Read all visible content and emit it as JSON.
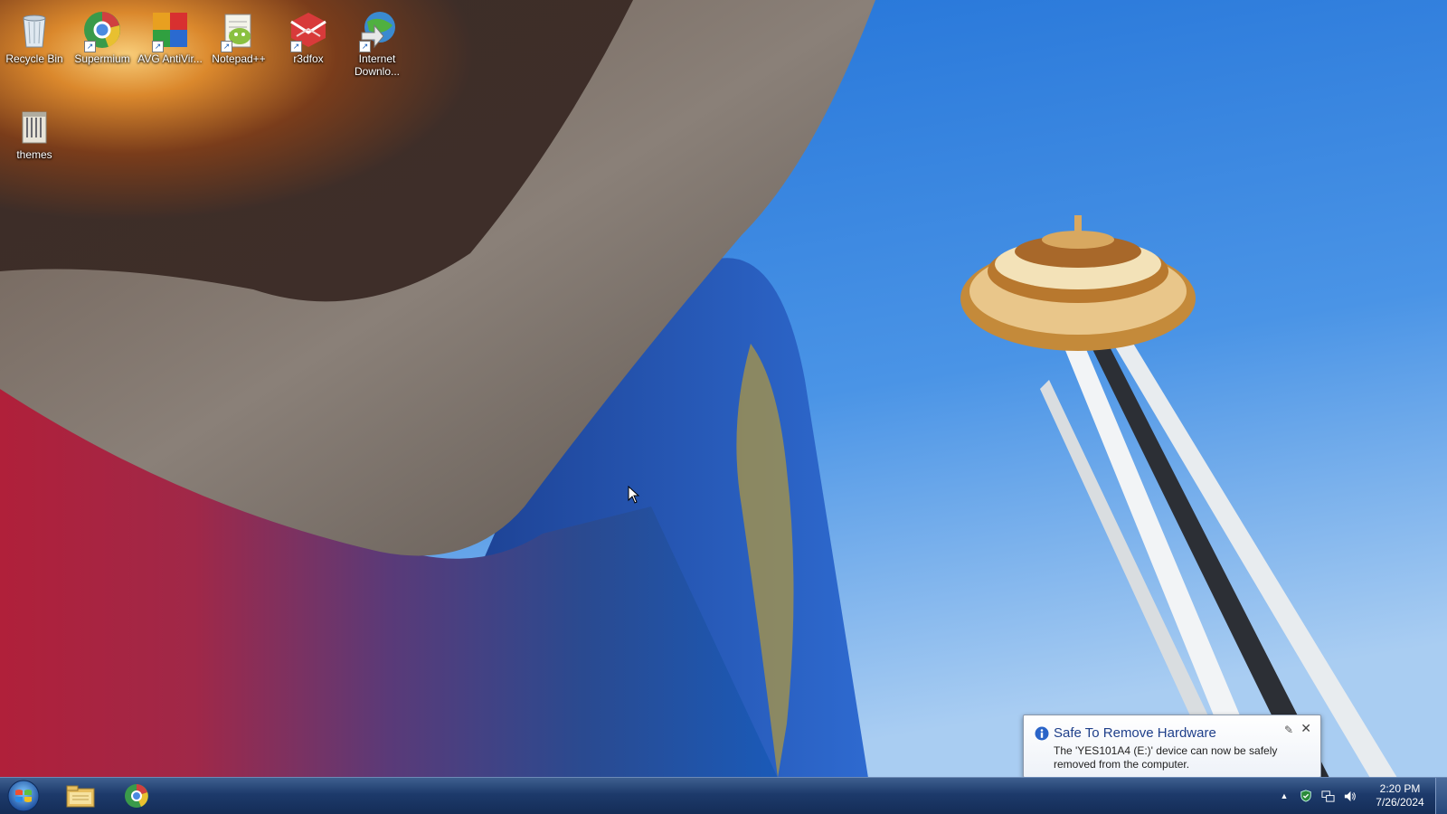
{
  "desktop": {
    "icons": [
      {
        "label": "Recycle Bin",
        "icon": "recycle-bin-icon"
      },
      {
        "label": "Supermium",
        "icon": "supermium-icon"
      },
      {
        "label": "AVG AntiVir...",
        "icon": "avg-antivirus-icon"
      },
      {
        "label": "Notepad++",
        "icon": "notepad-plus-plus-icon"
      },
      {
        "label": "r3dfox",
        "icon": "r3dfox-icon"
      },
      {
        "label": "Internet Downlo...",
        "icon": "internet-download-manager-icon"
      },
      {
        "label": "themes",
        "icon": "themes-folder-icon"
      }
    ]
  },
  "notification": {
    "title": "Safe To Remove Hardware",
    "message": "The 'YES101A4 (E:)' device can now be safely removed from the computer.",
    "icon": "info-icon",
    "close": "✕",
    "pin": "✎"
  },
  "taskbar": {
    "start_icon": "windows-orb-icon",
    "pinned": [
      {
        "icon": "file-explorer-icon"
      },
      {
        "icon": "supermium-icon"
      }
    ],
    "tray": {
      "overflow": "▲",
      "icons": [
        "security-shield-icon",
        "network-icon",
        "volume-icon"
      ]
    },
    "clock": {
      "time": "2:20 PM",
      "date": "7/26/2024"
    }
  },
  "colors": {
    "taskbar": "#1d3a6b",
    "sky": "#3b8be0",
    "balloon_title": "#1e3f8a"
  }
}
